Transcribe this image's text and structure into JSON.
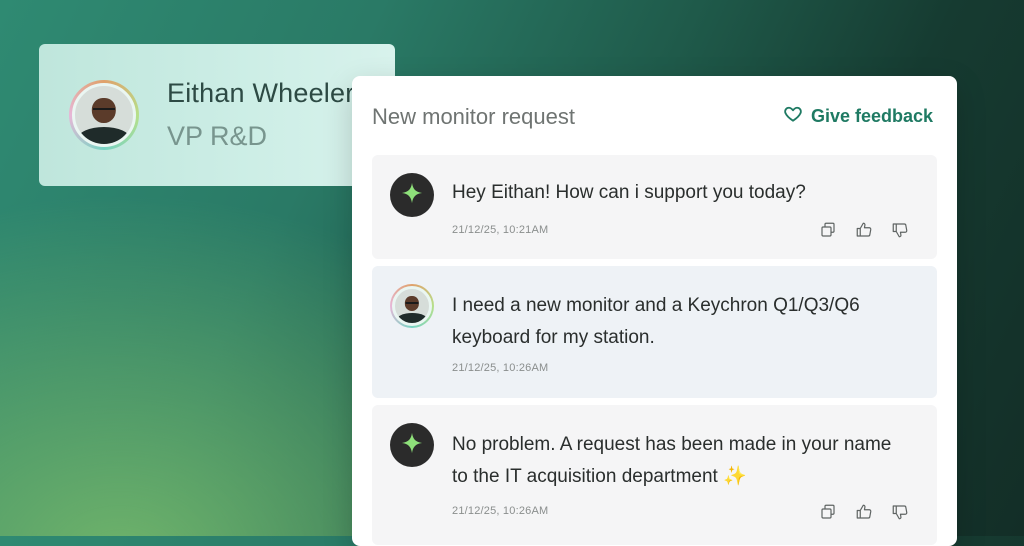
{
  "profile": {
    "name": "Eithan Wheeler",
    "role": "VP R&D"
  },
  "chat": {
    "title": "New monitor request",
    "feedback_label": "Give feedback",
    "messages": [
      {
        "sender": "assistant",
        "text": "Hey Eithan! How can i support you today?",
        "timestamp": "21/12/25, 10:21AM"
      },
      {
        "sender": "user",
        "text": "I need a new monitor and a Keychron Q1/Q3/Q6 keyboard for my station.",
        "timestamp": "21/12/25, 10:26AM"
      },
      {
        "sender": "assistant",
        "text": "No problem. A request has been made in your name to the IT acquisition department ✨",
        "timestamp": "21/12/25, 10:26AM"
      }
    ]
  },
  "icons": {
    "feedback": "heart-icon",
    "assistant": "sparkle-icon",
    "copy": "copy-icon",
    "like": "thumbs-up-icon",
    "dislike": "thumbs-down-icon"
  },
  "colors": {
    "accent": "#1f7a63",
    "sparkle": "#8ee07a"
  }
}
